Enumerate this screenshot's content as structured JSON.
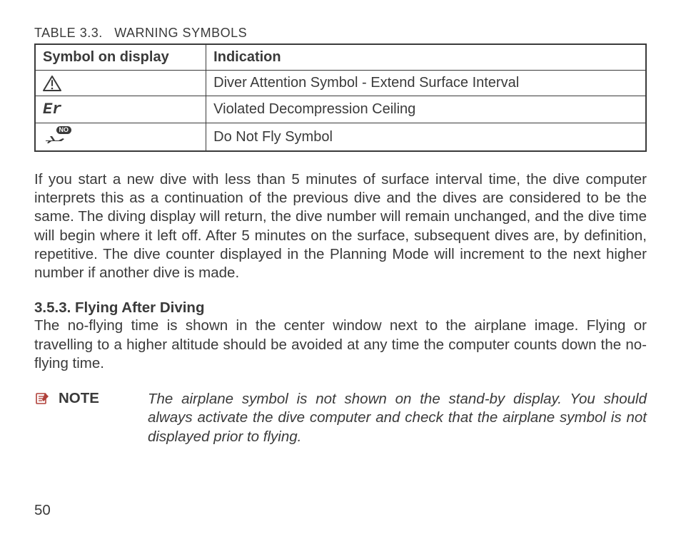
{
  "table": {
    "caption_prefix": "TABLE 3.3.",
    "caption_title": "WARNING SYMBOLS",
    "headers": {
      "symbol": "Symbol on display",
      "indication": "Indication"
    },
    "rows": {
      "attention": {
        "indication": "Diver Attention Symbol - Extend Surface Interval"
      },
      "error": {
        "symbol_text": "Er",
        "indication": "Violated Decompression Ceiling"
      },
      "nofly": {
        "badge": "NO",
        "indication": "Do Not Fly Symbol"
      }
    }
  },
  "paragraph1": "If you start a new dive with less than 5 minutes of surface interval time, the dive computer interprets this as a continuation of the previous dive and the dives are considered to be the same. The diving display will return, the dive number will remain unchanged, and the dive time will begin where it left off. After 5 minutes on the surface, subsequent dives are, by definition, repetitive. The dive counter displayed in the Planning Mode will increment to the next higher number if another dive is made.",
  "section": {
    "number": "3.5.3.",
    "title": "Flying After Diving",
    "body": "The no-flying time is shown in the center window next to the airplane image. Flying or travelling to a higher altitude should be avoided at any time the computer counts down the no-flying time."
  },
  "note": {
    "label": "NOTE",
    "text": "The airplane symbol is not shown on the stand-by display. You should always activate the dive computer and check that the airplane symbol is not displayed prior to flying."
  },
  "page_number": "50"
}
